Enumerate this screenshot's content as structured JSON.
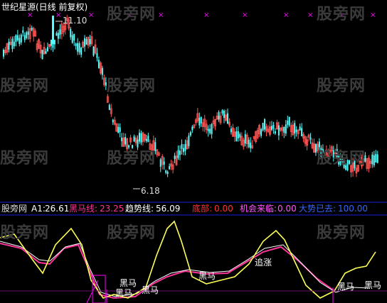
{
  "window": {
    "title": "世纪星源(日线 前复权)"
  },
  "watermark": "股旁网",
  "price_panel": {
    "high_label": "11.10",
    "low_label": "6.18"
  },
  "indicator_panel": {
    "name": "股旁网",
    "readouts": [
      {
        "label": "A1:",
        "value": "26.61",
        "color": "#ffffff"
      },
      {
        "label": "黑马线:",
        "value": "23.25",
        "color": "#ff3399"
      },
      {
        "label": "趋势线:",
        "value": "56.09",
        "color": "#ffffff"
      },
      {
        "label": "底部:",
        "value": "0.00",
        "color": "#ff3333"
      },
      {
        "label": "机会来临:",
        "value": "0.00",
        "color": "#ff55ff"
      },
      {
        "label": "大势已去:",
        "value": "100.00",
        "color": "#3366ff"
      }
    ],
    "annotations": [
      "黑马",
      "黑马",
      "黑马",
      "黑马",
      "追涨",
      "黑马",
      "黑马"
    ]
  },
  "colors": {
    "up": "#ff5555",
    "down": "#54fcfc",
    "trend_line": "#ffff55",
    "darkhorse_line": "#ff3399",
    "a1_line": "#ffffff",
    "separator": "#1c1cd8",
    "magenta": "#ff00ff"
  }
}
